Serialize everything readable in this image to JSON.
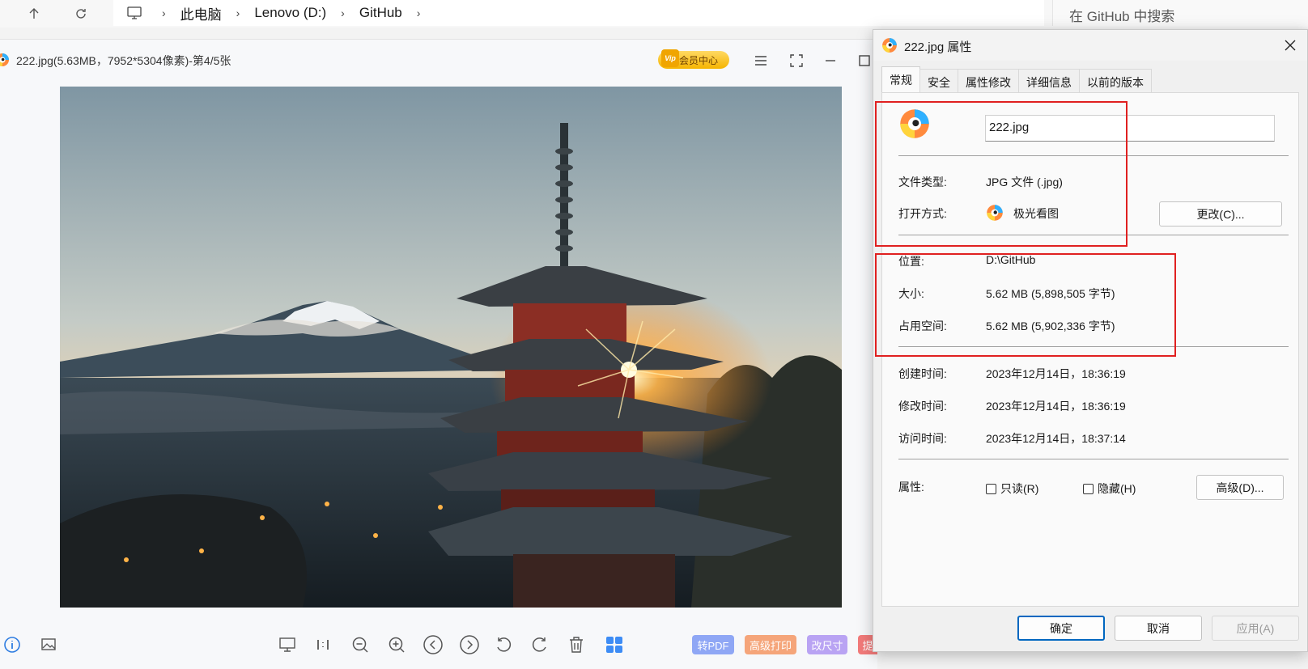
{
  "explorer": {
    "breadcrumbs": [
      "此电脑",
      "Lenovo (D:)",
      "GitHub"
    ],
    "search_placeholder": "在 GitHub 中搜索"
  },
  "viewer": {
    "title": "222.jpg(5.63MB，7952*5304像素)-第4/5张",
    "vip_label": "会员中心",
    "vip_badge": "Vip",
    "chips": [
      {
        "label": "转PDF",
        "color": "#8fa7f5"
      },
      {
        "label": "高级打印",
        "color": "#f5a57a"
      },
      {
        "label": "改尺寸",
        "color": "#b9a3f3"
      },
      {
        "label": "提",
        "color": "#f27a7a"
      }
    ]
  },
  "dialog": {
    "title": "222.jpg 属性",
    "tabs": [
      "常规",
      "安全",
      "属性修改",
      "详细信息",
      "以前的版本"
    ],
    "filename": "222.jpg",
    "file_type_label": "文件类型:",
    "file_type_value": "JPG 文件 (.jpg)",
    "open_with_label": "打开方式:",
    "open_with_value": "极光看图",
    "change_button": "更改(C)...",
    "location_label": "位置:",
    "location_value": "D:\\GitHub",
    "size_label": "大小:",
    "size_value": "5.62 MB (5,898,505 字节)",
    "disk_size_label": "占用空间:",
    "disk_size_value": "5.62 MB (5,902,336 字节)",
    "created_label": "创建时间:",
    "created_value": "2023年12月14日，18:36:19",
    "modified_label": "修改时间:",
    "modified_value": "2023年12月14日，18:36:19",
    "accessed_label": "访问时间:",
    "accessed_value": "2023年12月14日，18:37:14",
    "attributes_label": "属性:",
    "readonly_label": "只读(R)",
    "hidden_label": "隐藏(H)",
    "advanced_button": "高级(D)...",
    "ok_button": "确定",
    "cancel_button": "取消",
    "apply_button": "应用(A)"
  },
  "colors": {
    "highlight_box": "#e02020",
    "accent": "#0067c0"
  }
}
